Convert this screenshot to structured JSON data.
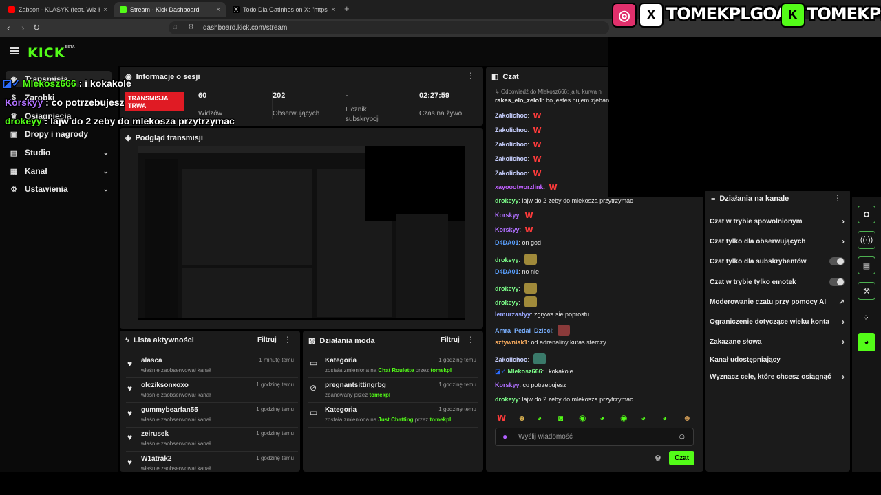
{
  "tabs": [
    {
      "title": "Zabson - KLASYK (feat. Wiz Khalifa)",
      "color": "#ff0000"
    },
    {
      "title": "Stream - Kick Dashboard",
      "color": "#53fc18"
    },
    {
      "title": "Todo Dia Gatinhos    on X: \"https://",
      "color": "#000000"
    }
  ],
  "url": "dashboard.kick.com/stream",
  "logo": "KICK",
  "logo_sup": "BETA",
  "sidebar": [
    {
      "label": "Transmisja",
      "icon": "broadcast-icon"
    },
    {
      "label": "Zarobki",
      "icon": "money-icon"
    },
    {
      "label": "Osiągnięcia",
      "icon": "trophy-icon"
    },
    {
      "label": "Dropy i nagrody",
      "icon": "gift-icon"
    },
    {
      "label": "Studio",
      "icon": "studio-icon",
      "chev": "⌄"
    },
    {
      "label": "Kanał",
      "icon": "channel-icon",
      "chev": "⌄"
    },
    {
      "label": "Ustawienia",
      "icon": "gear-icon",
      "chev": "⌄"
    }
  ],
  "session": {
    "title": "Informacje o sesji",
    "live_badge": "TRANSMISJA TRWA",
    "stats": [
      {
        "value": "60",
        "label": "Widzów"
      },
      {
        "value": "202",
        "label": "Obserwujących"
      },
      {
        "value": "-",
        "label": "Licznik subskrypcji"
      },
      {
        "value": "02:27:59",
        "label": "Czas na żywo"
      }
    ]
  },
  "preview": {
    "title": "Podgląd transmisji"
  },
  "activity": {
    "title": "Lista aktywności",
    "filter": "Filtruj",
    "items": [
      {
        "name": "alasca",
        "desc": "właśnie zaobserwował kanał",
        "time": "1 minutę temu"
      },
      {
        "name": "olcziksonxoxo",
        "desc": "właśnie zaobserwował kanał",
        "time": "1 godzinę temu"
      },
      {
        "name": "gummybearfan55",
        "desc": "właśnie zaobserwował kanał",
        "time": "1 godzinę temu"
      },
      {
        "name": "zeirusek",
        "desc": "właśnie zaobserwował kanał",
        "time": "1 godzinę temu"
      },
      {
        "name": "W1atrak2",
        "desc": "właśnie zaobserwował kanał",
        "time": "1 godzinę temu"
      }
    ]
  },
  "mod": {
    "title": "Działania moda",
    "filter": "Filtruj",
    "items": [
      {
        "name": "Kategoria",
        "pre": "została zmieniona na ",
        "hl": "Chat Roulette",
        "mid": " przez ",
        "by": "tomekpl",
        "time": "1 godzinę temu",
        "icon": "category-icon"
      },
      {
        "name": "pregnantsittingrbg",
        "pre": "zbanowany przez ",
        "hl": "",
        "mid": "",
        "by": "tomekpl",
        "time": "1 godzinę temu",
        "icon": "ban-icon"
      },
      {
        "name": "Kategoria",
        "pre": "została zmieniona na ",
        "hl": "Just Chatting",
        "mid": " przez ",
        "by": "tomekpl",
        "time": "1 godzinę temu",
        "icon": "category-icon"
      }
    ]
  },
  "chat": {
    "title": "Czat",
    "reply": "Odpowiedź do Mlekosz666: ja tu kurwa n",
    "messages": [
      {
        "user": "rakes_elo_zelo1",
        "color": "#e8e8e8",
        "text": "bo jestes hujem zjeban"
      },
      {
        "user": "Zakolichoo",
        "color": "#c8d0ff",
        "text": "",
        "emote": "W"
      },
      {
        "user": "Zakolichoo",
        "color": "#c8d0ff",
        "text": "",
        "emote": "W"
      },
      {
        "user": "Zakolichoo",
        "color": "#c8d0ff",
        "text": "",
        "emote": "W"
      },
      {
        "user": "Zakolichoo",
        "color": "#c8d0ff",
        "text": "",
        "emote": "W"
      },
      {
        "user": "Zakolichoo",
        "color": "#c8d0ff",
        "text": "",
        "emote": "W"
      },
      {
        "user": "xayoootworzlink",
        "color": "#c060ff",
        "text": "",
        "emote": "W"
      },
      {
        "user": "drokeyy",
        "color": "#7dff8a",
        "text": "lajw do 2 zeby do mlekosza przytrzymac"
      },
      {
        "user": "Korskyy",
        "color": "#b070ff",
        "text": "",
        "emote": "W"
      },
      {
        "user": "Korskyy",
        "color": "#b070ff",
        "text": "",
        "emote": "W"
      },
      {
        "user": "D4DA01",
        "color": "#5aa0ff",
        "text": "on god"
      },
      {
        "user": "drokeyy",
        "color": "#7dff8a",
        "text": "",
        "emote": "img"
      },
      {
        "user": "D4DA01",
        "color": "#5aa0ff",
        "text": "no nie"
      },
      {
        "user": "drokeyy",
        "color": "#7dff8a",
        "text": "",
        "emote": "img"
      },
      {
        "user": "drokeyy",
        "color": "#7dff8a",
        "text": "",
        "emote": "img"
      },
      {
        "user": "lemurzastyy",
        "color": "#9aa8ff",
        "text": "zgrywa sie poprostu"
      },
      {
        "user": "Amra_Pedal_Dzieci",
        "color": "#7ab0ff",
        "text": "",
        "emote": "red"
      },
      {
        "user": "sztywniak1",
        "color": "#ffb060",
        "text": "od adrenaliny kutas sterczy"
      },
      {
        "user": "Zakolichoo",
        "color": "#c8d0ff",
        "text": "",
        "emote": "teal"
      },
      {
        "user": "Mlekosz666",
        "color": "#7dff8a",
        "text": "i kokakole"
      },
      {
        "user": "Korskyy",
        "color": "#b070ff",
        "text": "co potrzebujesz"
      },
      {
        "user": "drokeyy",
        "color": "#7dff8a",
        "text": "lajw do 2 zeby do mlekosza przytrzymac"
      }
    ],
    "placeholder": "Wyślij wiadomość",
    "send": "Czat"
  },
  "channel": {
    "title": "Działania na kanale",
    "items": [
      {
        "label": "Czat w trybie spowolnionym",
        "ctl": "arrow"
      },
      {
        "label": "Czat tylko dla obserwujących",
        "ctl": "arrow"
      },
      {
        "label": "Czat tylko dla subskrybentów",
        "ctl": "toggle"
      },
      {
        "label": "Czat w trybie tylko emotek",
        "ctl": "toggle"
      },
      {
        "label": "Moderowanie czatu przy pomocy AI",
        "ctl": "ext"
      },
      {
        "label": "Ograniczenie dotyczące wieku konta",
        "ctl": "arrow"
      },
      {
        "label": "Zakazane słowa",
        "ctl": "arrow"
      },
      {
        "label": "Kanał udostępniający",
        "ctl": "none"
      },
      {
        "label": "Wyznacz cele, które chcesz osiągnąć",
        "ctl": "arrow"
      }
    ]
  },
  "overlay": {
    "social1": "TOMEKPLGOAT",
    "social2": "TOMEKPL",
    "chat": [
      {
        "user": "Mlekosz666",
        "sep": " : ",
        "text": "i kokakole"
      },
      {
        "user": "Korskyy",
        "sep": " : ",
        "text": "co potrzebujesz"
      },
      {
        "user": "drokeyy",
        "sep": " : ",
        "text": "lajw do 2 zeby do mlekosza przytrzymac"
      }
    ]
  }
}
